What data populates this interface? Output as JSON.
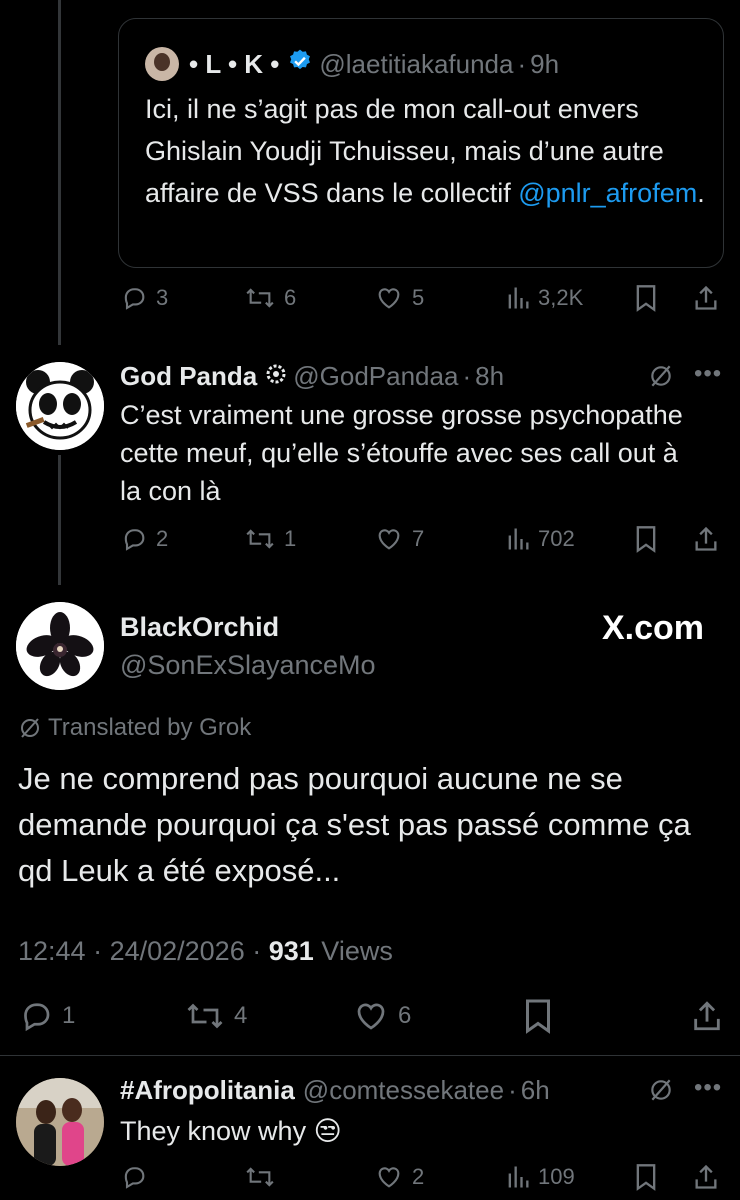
{
  "quoted": {
    "name": "• L • K •",
    "handle": "@laetitiakafunda",
    "time": "9h",
    "body_before_link": "Ici, il ne s’agit pas de mon call-out envers Ghislain Youdji Tchuisseu, mais d’une autre affaire de VSS dans le collectif ",
    "link": "@pnlr_afrofem",
    "body_after_link": "."
  },
  "quote_actions": {
    "replies": "3",
    "reposts": "6",
    "likes": "5",
    "views": "3,2K"
  },
  "reply1": {
    "name": "God Panda",
    "handle": "@GodPandaa",
    "time": "8h",
    "text": "C’est vraiment une grosse grosse psychopathe cette meuf, qu’elle s’étouffe avec ses call out à la con là",
    "replies": "2",
    "reposts": "1",
    "likes": "7",
    "views": "702"
  },
  "main": {
    "name": "BlackOrchid",
    "handle": "@SonExSlayanceMo",
    "brand": "X.com",
    "translated": "Translated by Grok",
    "text": "Je ne comprend pas pourquoi aucune ne se demande pourquoi ça s'est pas passé comme ça qd Leuk a été exposé...",
    "time": "12:44",
    "date": "24/02/2026",
    "views_count": "931",
    "views_label": "Views",
    "replies": "1",
    "reposts": "4",
    "likes": "6"
  },
  "reply2": {
    "name": "#Afropolitania",
    "handle": "@comtessekatee",
    "time": "6h",
    "text": "They know why",
    "emoji": "😒",
    "likes": "2",
    "views": "109"
  },
  "colors": {
    "background": "#000000",
    "text": "#e7e9ea",
    "muted": "#71767b",
    "link": "#1d9bf0",
    "border": "#2f3336"
  }
}
